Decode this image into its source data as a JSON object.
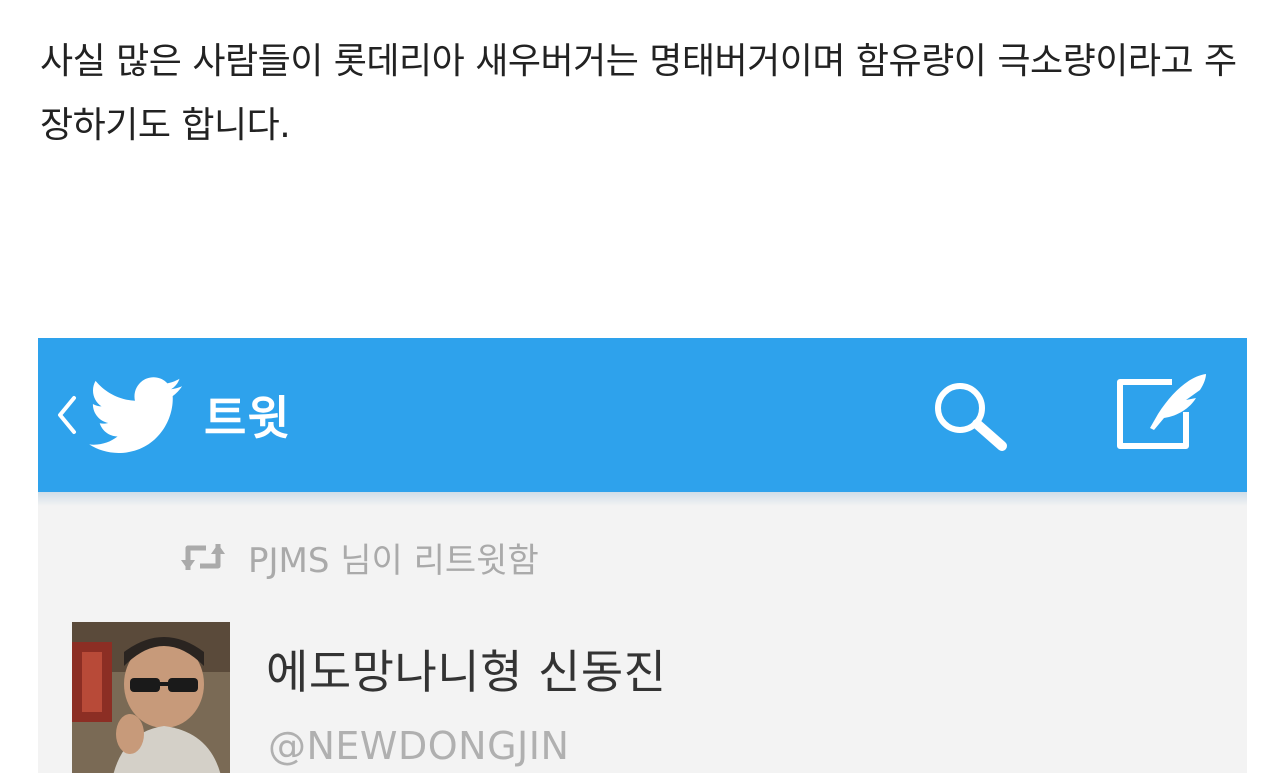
{
  "article": {
    "text": "사실 많은 사람들이 롯데리아 새우버거는 명태버거이며 함유량이 극소량이라고 주장하기도 합니다."
  },
  "twitter": {
    "title": "트윗",
    "retweet_text": "PJMS 님이 리트윗함",
    "user_name": "에도망나니형 신동진",
    "user_handle": "@NEWDONGJIN",
    "icons": {
      "back": "chevron-left-icon",
      "logo": "twitter-bird-icon",
      "search": "search-icon",
      "compose": "compose-icon",
      "retweet": "retweet-icon"
    },
    "colors": {
      "app_bar": "#2ea2ec",
      "title_text": "#ffffff",
      "secondary_text": "#aaaaaa"
    }
  }
}
